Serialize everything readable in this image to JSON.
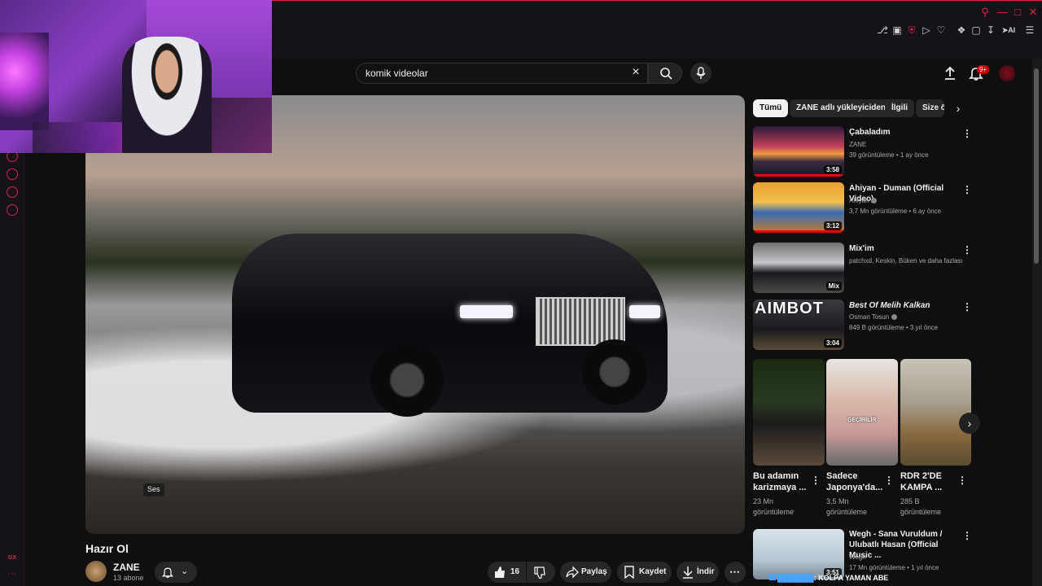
{
  "search": {
    "query": "komik videolar"
  },
  "header": {
    "notification_count": "9+"
  },
  "player": {
    "tooltip": "Ses"
  },
  "video": {
    "title": "Hazır Ol",
    "channel": "ZANE",
    "subscribers": "13 abone",
    "likes": "16",
    "share_label": "Paylaş",
    "save_label": "Kaydet",
    "download_label": "İndir"
  },
  "chips": [
    "Tümü",
    "ZANE adlı yükleyiciden",
    "İlgili",
    "Size ö"
  ],
  "related": [
    {
      "title": "Çabaladım",
      "channel": "ZANE",
      "meta": "39 görüntüleme • 1 ay önce",
      "duration": "3:58",
      "verified": false
    },
    {
      "title": "Ahiyan - Duman (Official Video)",
      "channel": "Ahiyan",
      "meta": "3,7 Mn görüntüleme • 6 ay önce",
      "duration": "3:12",
      "verified": true
    },
    {
      "title": "Mix'im",
      "channel": "patchxd, Keskin, Büken ve daha fazlası",
      "meta": "",
      "duration": "Mix",
      "verified": false
    },
    {
      "title": "Best Of Melih Kalkan",
      "channel": "Osman Tosun",
      "meta": "849 B görüntüleme • 3 yıl önce",
      "duration": "3:04",
      "verified": true,
      "thumb_text": "AIMBOT"
    },
    {
      "title": "Wegh -  Sana Vuruldum / Ulubatlı Hasan (Official Music ...",
      "channel": "Wegh",
      "meta": "17 Mn görüntüleme • 1 yıl önce",
      "duration": "3:51",
      "verified": false
    }
  ],
  "shorts": [
    {
      "title": "Bu adamın karizmaya ...",
      "views": "23 Mn",
      "views_label": "görüntüleme"
    },
    {
      "title": "Sadece Japonya'da...",
      "views": "3,5 Mn",
      "views_label": "görüntüleme",
      "thumb_text": "GEÇİRİLİR"
    },
    {
      "title": "RDR 2'DE KAMPA ...",
      "views": "285 B",
      "views_label": "görüntüleme"
    }
  ],
  "ticker": {
    "text": ": KOLPA YAMAN ABE"
  },
  "colors": {
    "accent": "#e0244d",
    "yt_red": "#cc0000",
    "bg": "#0f0f0f"
  }
}
